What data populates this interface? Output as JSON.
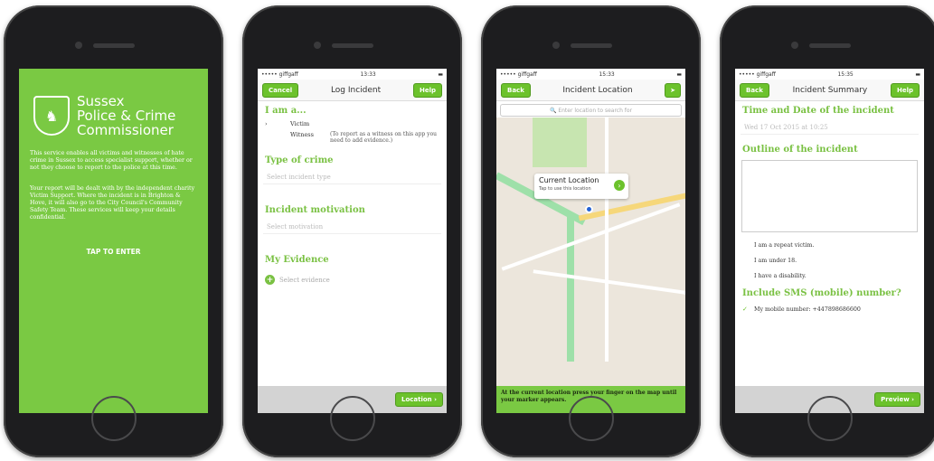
{
  "status": {
    "carrier": "••••• giffgaff",
    "time1": "13:33",
    "time2": "15:33",
    "time3": "15:35",
    "battery": "▬"
  },
  "screen1": {
    "logo_line1": "Sussex",
    "logo_line2": "Police & Crime",
    "logo_line3": "Commissioner",
    "para1": "This service enables all victims and witnesses of hate crime in Sussex to access specialist support, whether or not they choose to report to the police at this time.",
    "para2": "Your report will be dealt with by the independent charity Victim Support. Where the incident is in Brighton & Hove, it will also go to the City Council's Community Safety Team. These services will keep your details confidential.",
    "enter": "TAP TO ENTER"
  },
  "screen2": {
    "cancel": "Cancel",
    "title": "Log Incident",
    "help": "Help",
    "iam": "I am a...",
    "victim": "Victim",
    "witness": "Witness",
    "witness_note": "(To report as a witness on this app you need to add evidence.)",
    "type_h": "Type of crime",
    "type_ph": "Select incident type",
    "motive_h": "Incident motivation",
    "motive_ph": "Select motivation",
    "evid_h": "My Evidence",
    "evid_ph": "Select evidence",
    "location_btn": "Location ›"
  },
  "screen3": {
    "back": "Back",
    "title": "Incident Location",
    "search_ph": "🔍 Enter location to search for",
    "callout_t": "Current Location",
    "callout_s": "Tap to use this location",
    "instruction": "At the current location press your finger on the map until your marker appears."
  },
  "screen4": {
    "back": "Back",
    "title": "Incident Summary",
    "help": "Help",
    "time_h": "Time and Date of the incident",
    "time_val": "Wed 17 Oct 2015 at 10:25",
    "outline_h": "Outline of the incident",
    "repeat": "I am a repeat victim.",
    "under18": "I am under 18.",
    "disability": "I have a disability.",
    "sms_h": "Include SMS (mobile) number?",
    "mobile": "My mobile number: +447898686600",
    "preview": "Preview ›"
  }
}
